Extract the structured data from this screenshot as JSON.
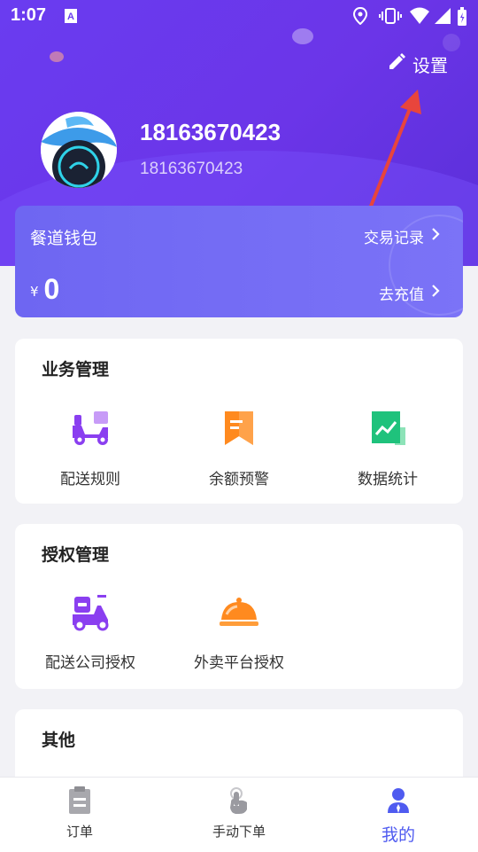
{
  "status_bar": {
    "time": "1:07"
  },
  "header": {
    "settings_label": "设置"
  },
  "profile": {
    "username": "18163670423",
    "phone": "18163670423"
  },
  "wallet": {
    "title": "餐道钱包",
    "records_label": "交易记录",
    "currency": "¥",
    "balance": "0",
    "recharge_label": "去充值"
  },
  "business": {
    "title": "业务管理",
    "items": [
      {
        "label": "配送规则",
        "icon": "scooter-icon"
      },
      {
        "label": "余额预警",
        "icon": "bookmark-icon"
      },
      {
        "label": "数据统计",
        "icon": "chart-icon"
      }
    ]
  },
  "auth": {
    "title": "授权管理",
    "items": [
      {
        "label": "配送公司授权",
        "icon": "delivery-scooter-icon"
      },
      {
        "label": "外卖平台授权",
        "icon": "cloche-icon"
      }
    ]
  },
  "other": {
    "title": "其他"
  },
  "tabbar": {
    "tabs": [
      {
        "label": "订单",
        "icon": "clipboard-icon"
      },
      {
        "label": "手动下单",
        "icon": "hand-pointer-icon"
      },
      {
        "label": "我的",
        "icon": "person-icon"
      }
    ],
    "active": 2
  },
  "colors": {
    "primary": "#6a3cf0",
    "accent": "#4f5bf0",
    "orange": "#ff8a1f",
    "green": "#1fc27c"
  }
}
